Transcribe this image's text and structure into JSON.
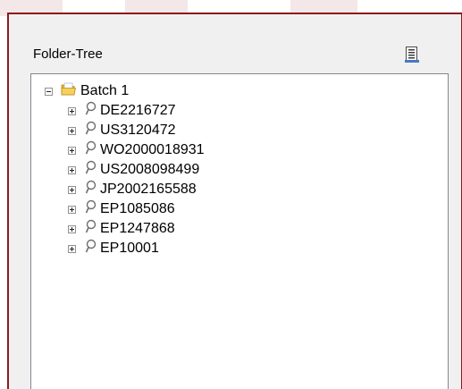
{
  "panel": {
    "title": "Folder-Tree",
    "button_icon": "document-list-icon"
  },
  "tree": {
    "root": {
      "label": "Batch 1",
      "icon": "folder-icon",
      "expanded": true
    },
    "children": [
      {
        "label": "DE2216727",
        "icon": "search-icon",
        "expanded": false
      },
      {
        "label": "US3120472",
        "icon": "search-icon",
        "expanded": false
      },
      {
        "label": "WO2000018931",
        "icon": "search-icon",
        "expanded": false
      },
      {
        "label": "US2008098499",
        "icon": "search-icon",
        "expanded": false
      },
      {
        "label": "JP2002165588",
        "icon": "search-icon",
        "expanded": false
      },
      {
        "label": "EP1085086",
        "icon": "search-icon",
        "expanded": false
      },
      {
        "label": "EP1247868",
        "icon": "search-icon",
        "expanded": false
      },
      {
        "label": "EP10001",
        "icon": "search-icon",
        "expanded": false
      }
    ]
  },
  "colors": {
    "window_border": "#8b1a1a",
    "panel_background": "#f0f0f0",
    "tree_border": "#828790",
    "folder_yellow": "#f2c14e"
  }
}
